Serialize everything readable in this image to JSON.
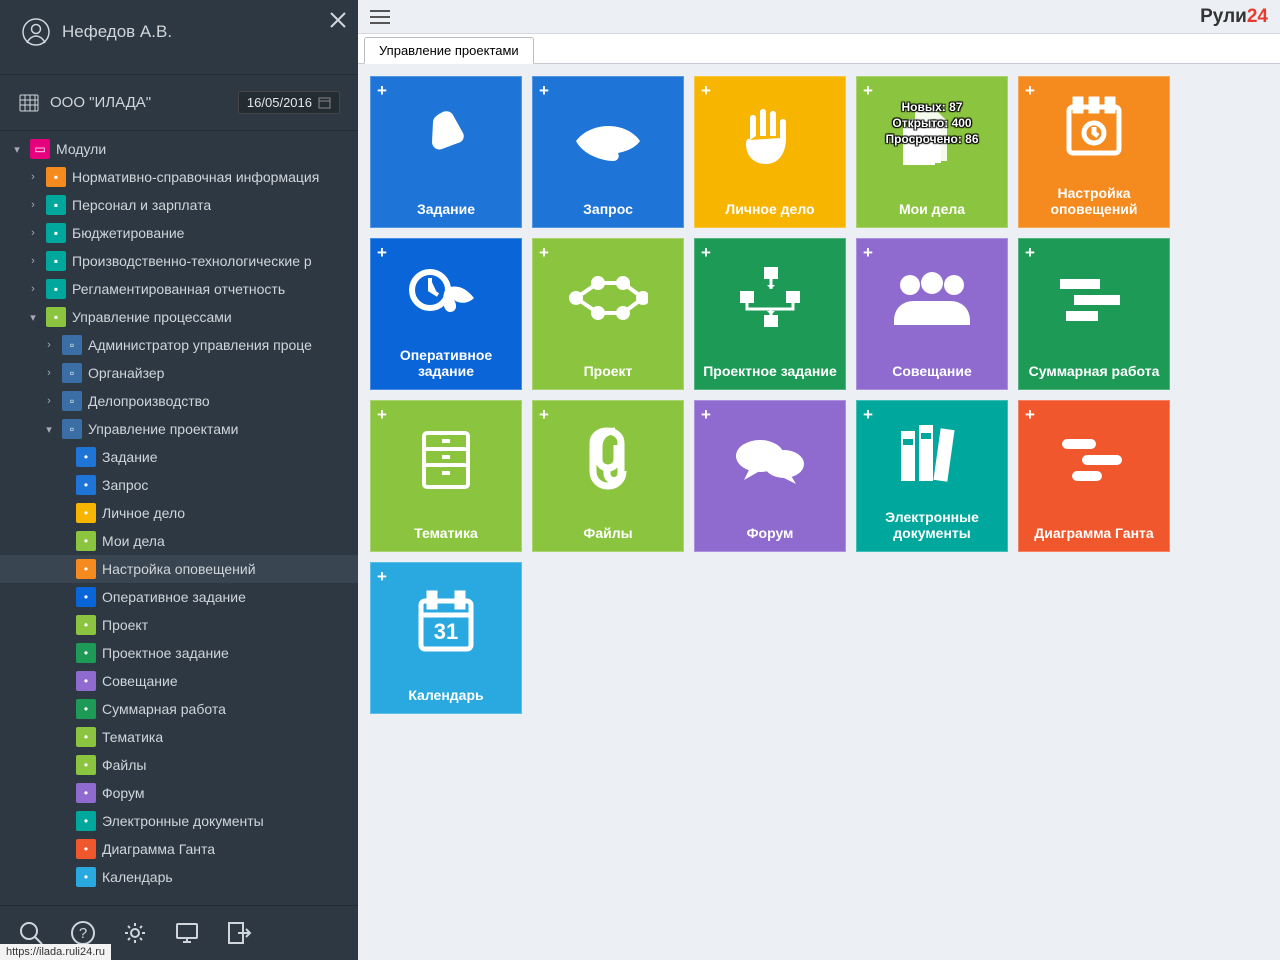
{
  "user": {
    "name": "Нефедов А.В."
  },
  "org": {
    "name": "ООО \"ИЛАДА\"",
    "date": "16/05/2016"
  },
  "brand": {
    "part1": "Рули",
    "part2": "24"
  },
  "tab": {
    "label": "Управление проектами"
  },
  "status_url": "https://ilada.ruli24.ru",
  "tree": {
    "root": "Модули",
    "mods": [
      "Нормативно-справочная информация",
      "Персонал и зарплата",
      "Бюджетирование",
      "Производственно-технологические р",
      "Регламентированная отчетность",
      "Управление процессами"
    ],
    "proc": [
      "Администратор управления проце",
      "Органайзер",
      "Делопроизводство",
      "Управление проектами"
    ],
    "proj": [
      "Задание",
      "Запрос",
      "Личное дело",
      "Мои дела",
      "Настройка оповещений",
      "Оперативное задание",
      "Проект",
      "Проектное задание",
      "Совещание",
      "Суммарная работа",
      "Тематика",
      "Файлы",
      "Форум",
      "Электронные документы",
      "Диаграмма Ганта",
      "Календарь"
    ]
  },
  "tiles": [
    {
      "label": "Задание",
      "color": "#1e74d7"
    },
    {
      "label": "Запрос",
      "color": "#1e74d7"
    },
    {
      "label": "Личное дело",
      "color": "#f7b500"
    },
    {
      "label": "Мои дела",
      "color": "#8bc53f",
      "stats": {
        "new": "Новых: 87",
        "open": "Открыто: 400",
        "overdue": "Просрочено: 86"
      }
    },
    {
      "label": "Настройка оповещений",
      "color": "#f58a1f"
    },
    {
      "label": "Оперативное задание",
      "color": "#0a66d8"
    },
    {
      "label": "Проект",
      "color": "#8bc53f"
    },
    {
      "label": "Проектное задание",
      "color": "#1c9a56"
    },
    {
      "label": "Совещание",
      "color": "#8f6bd0"
    },
    {
      "label": "Суммарная работа",
      "color": "#1c9a56"
    },
    {
      "label": "Тематика",
      "color": "#8bc53f"
    },
    {
      "label": "Файлы",
      "color": "#8bc53f"
    },
    {
      "label": "Форум",
      "color": "#8f6bd0"
    },
    {
      "label": "Электронные документы",
      "color": "#00a79d"
    },
    {
      "label": "Диаграмма Ганта",
      "color": "#f0572d"
    },
    {
      "label": "Календарь",
      "color": "#29a9e0"
    }
  ],
  "tree_colors": {
    "mod_icons": [
      "#f58a1f",
      "#00a79d",
      "#00a79d",
      "#00a79d",
      "#00a79d",
      "#8bc53f"
    ],
    "proc_icons": [
      "#3a6ea5",
      "#3a6ea5",
      "#3a6ea5",
      "#3a6ea5"
    ],
    "proj_icons": [
      "#1e74d7",
      "#1e74d7",
      "#f7b500",
      "#8bc53f",
      "#f58a1f",
      "#0a66d8",
      "#8bc53f",
      "#1c9a56",
      "#8f6bd0",
      "#1c9a56",
      "#8bc53f",
      "#8bc53f",
      "#8f6bd0",
      "#00a79d",
      "#f0572d",
      "#29a9e0"
    ]
  }
}
